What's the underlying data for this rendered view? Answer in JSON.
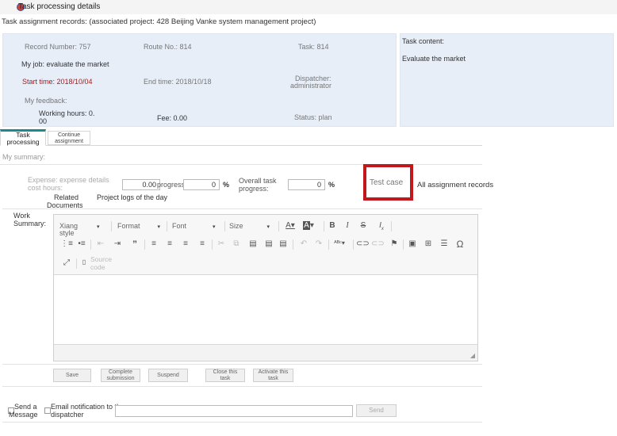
{
  "window": {
    "title": "Task processing details"
  },
  "records_title": "Task assignment records: (associated project: 428 Beijing Vanke system management project)",
  "info": {
    "record_number": "Record Number: 757",
    "route_no": "Route No.: 814",
    "task": "Task: 814",
    "my_job": "My job: evaluate the market",
    "start_time": "Start time: 2018/10/04",
    "end_time": "End time: 2018/10/18",
    "dispatcher_label": "Dispatcher:",
    "dispatcher_value": "administrator",
    "my_feedback": "My feedback:",
    "working_hours_l1": "Working hours: 0.",
    "working_hours_l2": "00",
    "fee": "Fee: 0.00",
    "status": "Status: plan"
  },
  "content": {
    "label": "Task content:",
    "value": "Evaluate the market"
  },
  "tabs": {
    "task_processing_l1": "Task",
    "task_processing_l2": "processing",
    "continue_l1": "Continue",
    "continue_l2": "assignment"
  },
  "form": {
    "my_summary": "My summary:",
    "expense_l1": "Expense: expense details",
    "expense_l2": "cost hours:",
    "expense_value": "0.00",
    "progress_label": "progress:",
    "progress_value": "0",
    "percent": "%",
    "overall_l1": "Overall task",
    "overall_l2": "progress:",
    "overall_value": "0",
    "test_case": "Test case",
    "all_records": "All assignment records",
    "related_l1": "Related",
    "related_l2": "Documents",
    "project_logs": "Project logs of the day",
    "work_summary_l1": "Work",
    "work_summary_l2": "Summary:"
  },
  "editor": {
    "style_l1": "Xiang",
    "style_l2": "style",
    "format": "Format",
    "font": "Font",
    "size": "Size",
    "source_l1": "Source",
    "source_l2": "code"
  },
  "buttons": {
    "save": "Save",
    "complete_l1": "Complete",
    "complete_l2": "submission",
    "suspend": "Suspend",
    "close_l1": "Close this",
    "close_l2": "task",
    "activate_l1": "Activate this",
    "activate_l2": "task",
    "send": "Send"
  },
  "notify": {
    "send_message_l1": "Send a",
    "send_message_l2": "Message",
    "email_l1": "Email notification to the",
    "email_l2": "dispatcher"
  }
}
